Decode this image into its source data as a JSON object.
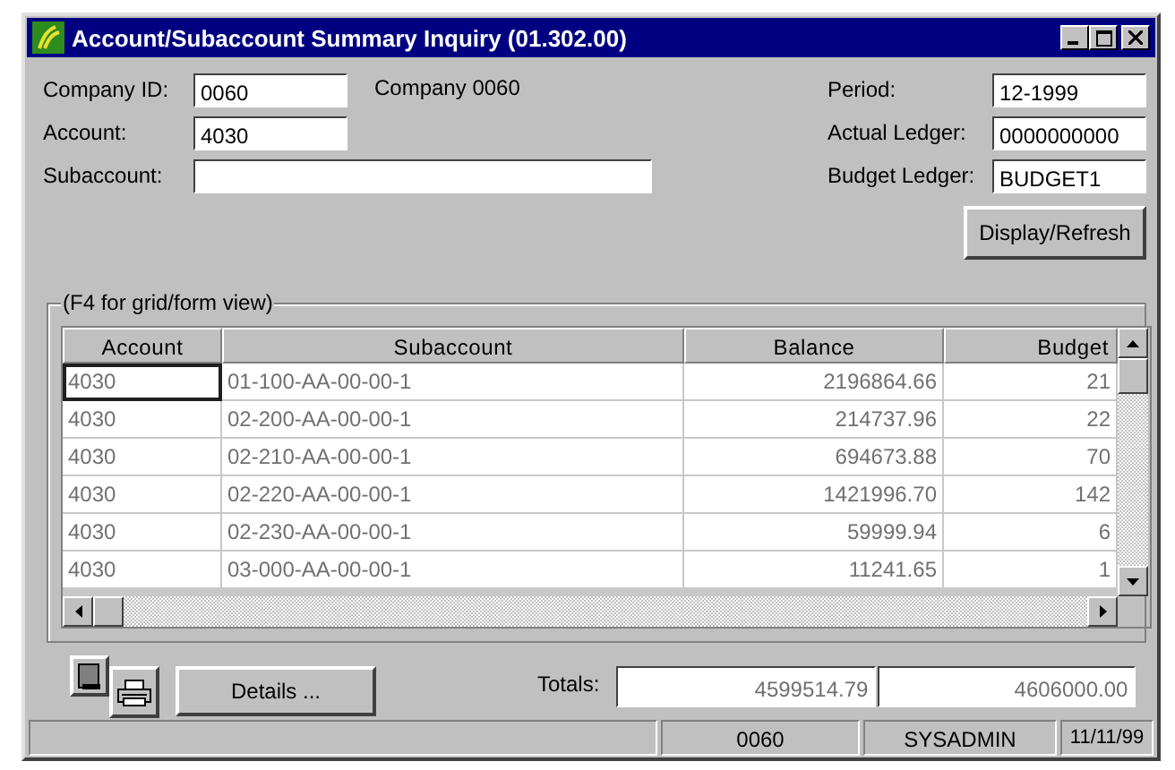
{
  "window": {
    "title": "Account/Subaccount Summary Inquiry (01.302.00)"
  },
  "form_left": [
    {
      "label": "Company ID:",
      "value": "0060",
      "note": "Company 0060"
    },
    {
      "label": "Account:",
      "value": "4030"
    },
    {
      "label": "Subaccount:"
    }
  ],
  "form_right": [
    {
      "label": "Period:",
      "value": "12-1999"
    },
    {
      "label": "Actual Ledger:",
      "value": "0000000000"
    },
    {
      "label": "Budget Ledger:",
      "value": "BUDGET1"
    }
  ],
  "display_button": {
    "label": "Display/Refresh"
  },
  "group": {
    "label": "(F4 for grid/form view)"
  },
  "grid": {
    "columns": [
      "Account",
      "Subaccount",
      "Balance",
      "Budget"
    ],
    "rows": [
      {
        "selected": true,
        "cells": [
          "4030",
          "01-100-AA-00-00-1",
          "2196864.66",
          "21"
        ]
      },
      {
        "selected": false,
        "cells": [
          "4030",
          "02-200-AA-00-00-1",
          "214737.96",
          "22"
        ]
      },
      {
        "selected": false,
        "cells": [
          "4030",
          "02-210-AA-00-00-1",
          "694673.88",
          "70"
        ]
      },
      {
        "selected": false,
        "cells": [
          "4030",
          "02-220-AA-00-00-1",
          "1421996.70",
          "142"
        ]
      },
      {
        "selected": false,
        "cells": [
          "4030",
          "02-230-AA-00-00-1",
          "59999.94",
          "6"
        ]
      },
      {
        "selected": false,
        "cells": [
          "4030",
          "03-000-AA-00-00-1",
          "11241.65",
          "1"
        ]
      }
    ]
  },
  "details_button": {
    "label": "Details ..."
  },
  "totals": {
    "label": "Totals:",
    "values": [
      "4599514.79",
      "4606000.00"
    ]
  },
  "status_bar": [
    "0060",
    "SYSADMIN",
    "11/11/99"
  ]
}
